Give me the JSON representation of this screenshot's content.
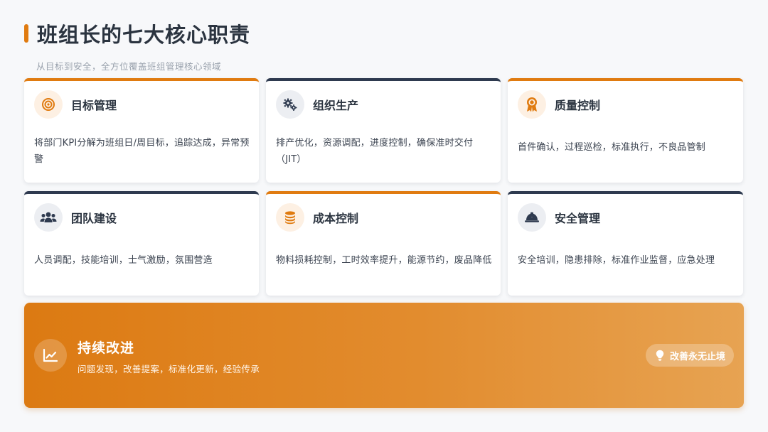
{
  "header": {
    "title": "班组长的七大核心职责",
    "subtitle": "从目标到安全，全方位覆盖班组管理核心领域"
  },
  "colors": {
    "accent": "#e07b10",
    "navy": "#2e3a4f",
    "background": "#f7f8fa"
  },
  "cards": [
    {
      "title": "目标管理",
      "desc": "将部门KPI分解为班组日/周目标，追踪达成，异常预警",
      "icon": "target-icon",
      "accent": "orange"
    },
    {
      "title": "组织生产",
      "desc": "排产优化，资源调配，进度控制，确保准时交付（JIT）",
      "icon": "gears-icon",
      "accent": "navy"
    },
    {
      "title": "质量控制",
      "desc": "首件确认，过程巡检，标准执行，不良品管制",
      "icon": "award-icon",
      "accent": "orange"
    },
    {
      "title": "团队建设",
      "desc": "人员调配，技能培训，士气激励，氛围营造",
      "icon": "users-icon",
      "accent": "navy"
    },
    {
      "title": "成本控制",
      "desc": "物料损耗控制，工时效率提升，能源节约，废品降低",
      "icon": "coins-icon",
      "accent": "orange"
    },
    {
      "title": "安全管理",
      "desc": "安全培训，隐患排除，标准作业监督，应急处理",
      "icon": "hardhat-icon",
      "accent": "navy"
    }
  ],
  "banner": {
    "title": "持续改进",
    "desc": "问题发现，改善提案，标准化更新，经验传承",
    "icon": "chart-line-icon",
    "badge_icon": "lightbulb-icon",
    "badge": "改善永无止境"
  }
}
